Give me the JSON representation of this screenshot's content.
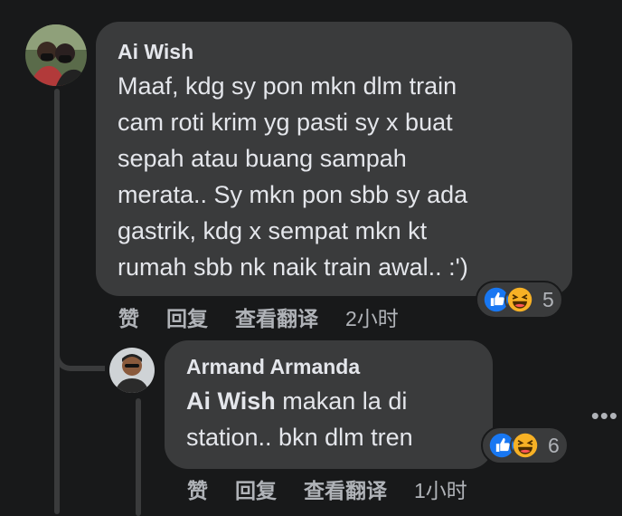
{
  "comment": {
    "author": "Ai Wish",
    "text": "Maaf, kdg sy pon mkn dlm train\ncam roti krim yg pasti sy x buat\nsepah atau buang sampah\nmerata.. Sy mkn pon sbb sy ada\ngastrik, kdg x sempat mkn kt\nrumah sbb nk naik train awal.. :')",
    "reactions": {
      "icons": [
        "like-icon",
        "haha-icon"
      ],
      "count": "5"
    },
    "actions": {
      "like": "赞",
      "reply": "回复",
      "translate": "查看翻译",
      "time": "2小时"
    }
  },
  "reply": {
    "author": "Armand Armanda",
    "mention": "Ai Wish",
    "text": " makan la di\nstation.. bkn dlm tren",
    "reactions": {
      "icons": [
        "like-icon",
        "haha-icon"
      ],
      "count": "6"
    },
    "actions": {
      "like": "赞",
      "reply": "回复",
      "translate": "查看翻译",
      "time": "1小时"
    }
  },
  "more_menu": {
    "label": "•••"
  },
  "colors": {
    "background": "#18191a",
    "bubble": "#3a3b3c",
    "text": "#e4e6eb",
    "muted": "#b0b3b8",
    "like": "#1877f2",
    "haha": "#f7b125"
  }
}
